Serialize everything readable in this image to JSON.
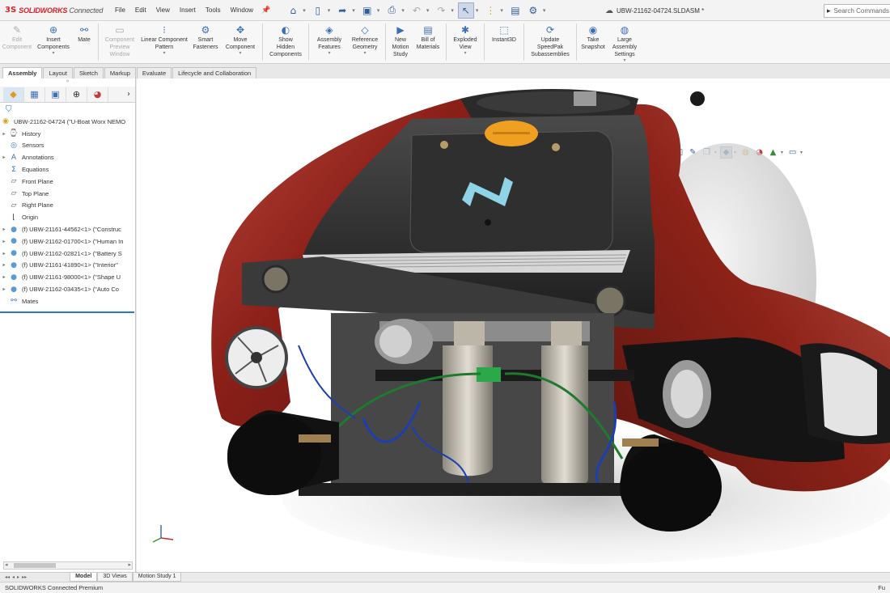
{
  "app": {
    "logo_mark": "3S",
    "logo_brand": "SOLIDWORKS",
    "logo_suffix": "Connected",
    "document_title": "UBW-21162-04724.SLDASM *"
  },
  "menu": [
    {
      "label": "File",
      "name": "menu-file"
    },
    {
      "label": "Edit",
      "name": "menu-edit"
    },
    {
      "label": "View",
      "name": "menu-view"
    },
    {
      "label": "Insert",
      "name": "menu-insert"
    },
    {
      "label": "Tools",
      "name": "menu-tools"
    },
    {
      "label": "Window",
      "name": "menu-window"
    }
  ],
  "search": {
    "placeholder": "Search Commands"
  },
  "ribbon": [
    {
      "id": "edit-component",
      "l1": "Edit",
      "l2": "Component",
      "l3": "",
      "icon": "✎",
      "disabled": true,
      "dd": false
    },
    {
      "id": "insert-components",
      "l1": "Insert",
      "l2": "Components",
      "l3": "",
      "icon": "⊕",
      "disabled": false,
      "dd": true
    },
    {
      "id": "mate",
      "l1": "Mate",
      "l2": "",
      "l3": "",
      "icon": "⚯",
      "disabled": false,
      "dd": false
    },
    {
      "id": "component-preview",
      "l1": "Component",
      "l2": "Preview",
      "l3": "Window",
      "icon": "▭",
      "disabled": true,
      "dd": false
    },
    {
      "id": "linear-pattern",
      "l1": "Linear Component",
      "l2": "Pattern",
      "l3": "",
      "icon": "⁝",
      "disabled": false,
      "dd": true
    },
    {
      "id": "smart-fasteners",
      "l1": "Smart",
      "l2": "Fasteners",
      "l3": "",
      "icon": "⚙",
      "disabled": false,
      "dd": false
    },
    {
      "id": "move-component",
      "l1": "Move",
      "l2": "Component",
      "l3": "",
      "icon": "✥",
      "disabled": false,
      "dd": true
    },
    {
      "id": "show-hidden",
      "l1": "Show",
      "l2": "Hidden",
      "l3": "Components",
      "icon": "◐",
      "disabled": false,
      "dd": false
    },
    {
      "id": "assembly-features",
      "l1": "Assembly",
      "l2": "Features",
      "l3": "",
      "icon": "◈",
      "disabled": false,
      "dd": true
    },
    {
      "id": "reference-geometry",
      "l1": "Reference",
      "l2": "Geometry",
      "l3": "",
      "icon": "◇",
      "disabled": false,
      "dd": true
    },
    {
      "id": "new-motion-study",
      "l1": "New",
      "l2": "Motion",
      "l3": "Study",
      "icon": "▶",
      "disabled": false,
      "dd": false
    },
    {
      "id": "bill-of-materials",
      "l1": "Bill of",
      "l2": "Materials",
      "l3": "",
      "icon": "▤",
      "disabled": false,
      "dd": false
    },
    {
      "id": "exploded-view",
      "l1": "Exploded",
      "l2": "View",
      "l3": "",
      "icon": "✱",
      "disabled": false,
      "dd": true
    },
    {
      "id": "instant3d",
      "l1": "Instant3D",
      "l2": "",
      "l3": "",
      "icon": "⬚",
      "disabled": false,
      "dd": false
    },
    {
      "id": "update-speedpak",
      "l1": "Update",
      "l2": "SpeedPak",
      "l3": "Subassemblies",
      "icon": "⟳",
      "disabled": false,
      "dd": false
    },
    {
      "id": "take-snapshot",
      "l1": "Take",
      "l2": "Snapshot",
      "l3": "",
      "icon": "◉",
      "disabled": false,
      "dd": false
    },
    {
      "id": "large-assembly",
      "l1": "Large",
      "l2": "Assembly",
      "l3": "Settings",
      "icon": "◍",
      "disabled": false,
      "dd": true
    }
  ],
  "command_tabs": [
    "Assembly",
    "Layout",
    "Sketch",
    "Markup",
    "Evaluate",
    "Lifecycle and Collaboration"
  ],
  "tree": {
    "root": "UBW-21162-04724 (\"U-Boat Worx NEMO",
    "items": [
      {
        "label": "History",
        "icon": "⌚",
        "color": "#3a6eb5",
        "expand": true
      },
      {
        "label": "Sensors",
        "icon": "◎",
        "color": "#3a6eb5",
        "expand": false
      },
      {
        "label": "Annotations",
        "icon": "A",
        "color": "#3a6eb5",
        "expand": true
      },
      {
        "label": "Equations",
        "icon": "Σ",
        "color": "#3a6eb5",
        "expand": false
      },
      {
        "label": "Front Plane",
        "icon": "▱",
        "color": "#555",
        "expand": false
      },
      {
        "label": "Top Plane",
        "icon": "▱",
        "color": "#555",
        "expand": false
      },
      {
        "label": "Right Plane",
        "icon": "▱",
        "color": "#555",
        "expand": false
      },
      {
        "label": "Origin",
        "icon": "⌊",
        "color": "#333",
        "expand": false
      },
      {
        "label": "(f) UBW-21161-44562<1> (\"Construc",
        "icon": "●",
        "color": "#5b9bd5",
        "expand": true
      },
      {
        "label": "(f) UBW-21162-01700<1> (\"Human In",
        "icon": "●",
        "color": "#5b9bd5",
        "expand": true
      },
      {
        "label": "(f) UBW-21162-02821<1> (\"Battery S",
        "icon": "●",
        "color": "#5b9bd5",
        "expand": true
      },
      {
        "label": "(f) UBW-21161-41890<1> (\"Interior\"",
        "icon": "●",
        "color": "#5b9bd5",
        "expand": true
      },
      {
        "label": "(f) UBW-21161-98000<1> (\"Shape U",
        "icon": "●",
        "color": "#5b9bd5",
        "expand": true
      },
      {
        "label": "(f) UBW-21162-03435<1> (\"Auto Co",
        "icon": "●",
        "color": "#5b9bd5",
        "expand": true
      },
      {
        "label": "Mates",
        "icon": "⚯",
        "color": "#3a6eb5",
        "expand": false
      }
    ]
  },
  "bottom_tabs": [
    "Model",
    "3D Views",
    "Motion Study 1"
  ],
  "status": {
    "left": "SOLIDWORKS Connected Premium",
    "right": "Fu"
  }
}
